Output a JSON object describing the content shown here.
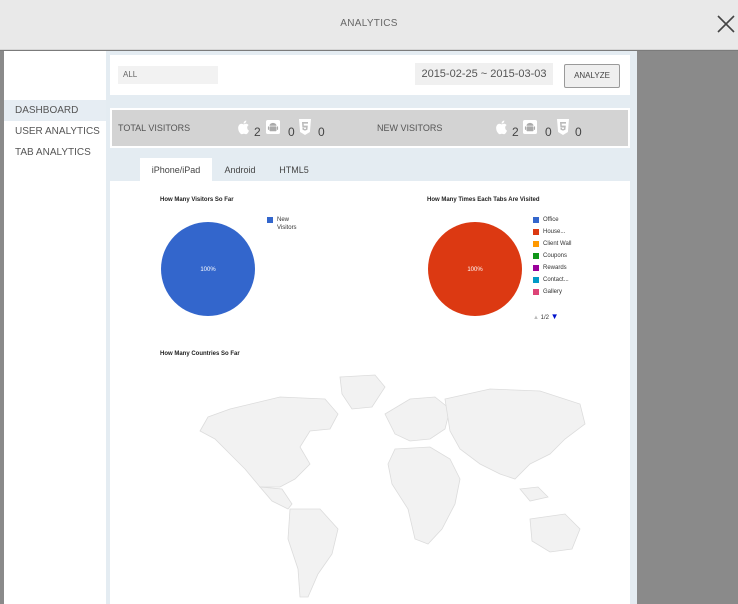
{
  "window": {
    "title": "ANALYTICS"
  },
  "sidebar": {
    "items": [
      {
        "label": "DASHBOARD"
      },
      {
        "label": "USER ANALYTICS"
      },
      {
        "label": "TAB ANALYTICS"
      }
    ]
  },
  "filters": {
    "scope_value": "ALL",
    "date_range": "2015-02-25 ~ 2015-03-03",
    "analyze_label": "ANALYZE"
  },
  "stats": {
    "total_label": "TOTAL VISITORS",
    "total_ios": "2",
    "total_android": "0",
    "total_html5": "0",
    "new_label": "NEW VISITORS",
    "new_ios": "2",
    "new_android": "0",
    "new_html5": "0"
  },
  "tabs": [
    {
      "label": "iPhone/iPad"
    },
    {
      "label": "Android"
    },
    {
      "label": "HTML5"
    }
  ],
  "colors": {
    "visitors_blue": "#3366cc",
    "tabs_red": "#dc3912"
  },
  "pager": {
    "text": "1/2"
  },
  "chart_data": [
    {
      "type": "pie",
      "title": "How Many Visitors So Far",
      "slices": [
        {
          "label": "New Visitors",
          "value": 100,
          "display": "100%",
          "color": "#3366cc"
        }
      ]
    },
    {
      "type": "pie",
      "title": "How Many Times Each Tabs Are Visited",
      "slices": [
        {
          "label": "Office",
          "value": 100,
          "display": "100%",
          "color": "#dc3912"
        }
      ],
      "legend": [
        {
          "label": "Office",
          "color": "#3366cc"
        },
        {
          "label": "House...",
          "color": "#dc3912"
        },
        {
          "label": "Client Wall",
          "color": "#ff9900"
        },
        {
          "label": "Coupons",
          "color": "#109618"
        },
        {
          "label": "Rewards",
          "color": "#990099"
        },
        {
          "label": "Contact...",
          "color": "#0099c6"
        },
        {
          "label": "Gallery",
          "color": "#dd4477"
        }
      ]
    },
    {
      "type": "map",
      "title": "How Many Countries So Far"
    }
  ]
}
